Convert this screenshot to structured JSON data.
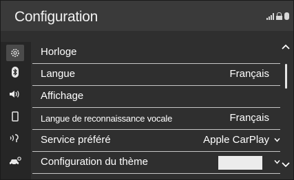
{
  "header": {
    "title": "Configuration"
  },
  "sidebar": {
    "items": [
      {
        "icon": "gear-icon"
      },
      {
        "icon": "bluetooth-icon"
      },
      {
        "icon": "speaker-icon"
      },
      {
        "icon": "phone-icon"
      },
      {
        "icon": "voice-icon"
      },
      {
        "icon": "car-settings-icon"
      }
    ]
  },
  "rows": [
    {
      "label": "Horloge",
      "value": ""
    },
    {
      "label": "Langue",
      "value": "Français"
    },
    {
      "label": "Affichage",
      "value": ""
    },
    {
      "label": "Langue de reconnaissance vocale",
      "value": "Français"
    },
    {
      "label": "Service préféré",
      "value": "Apple CarPlay"
    },
    {
      "label": "Configuration du thème",
      "value": ""
    }
  ]
}
